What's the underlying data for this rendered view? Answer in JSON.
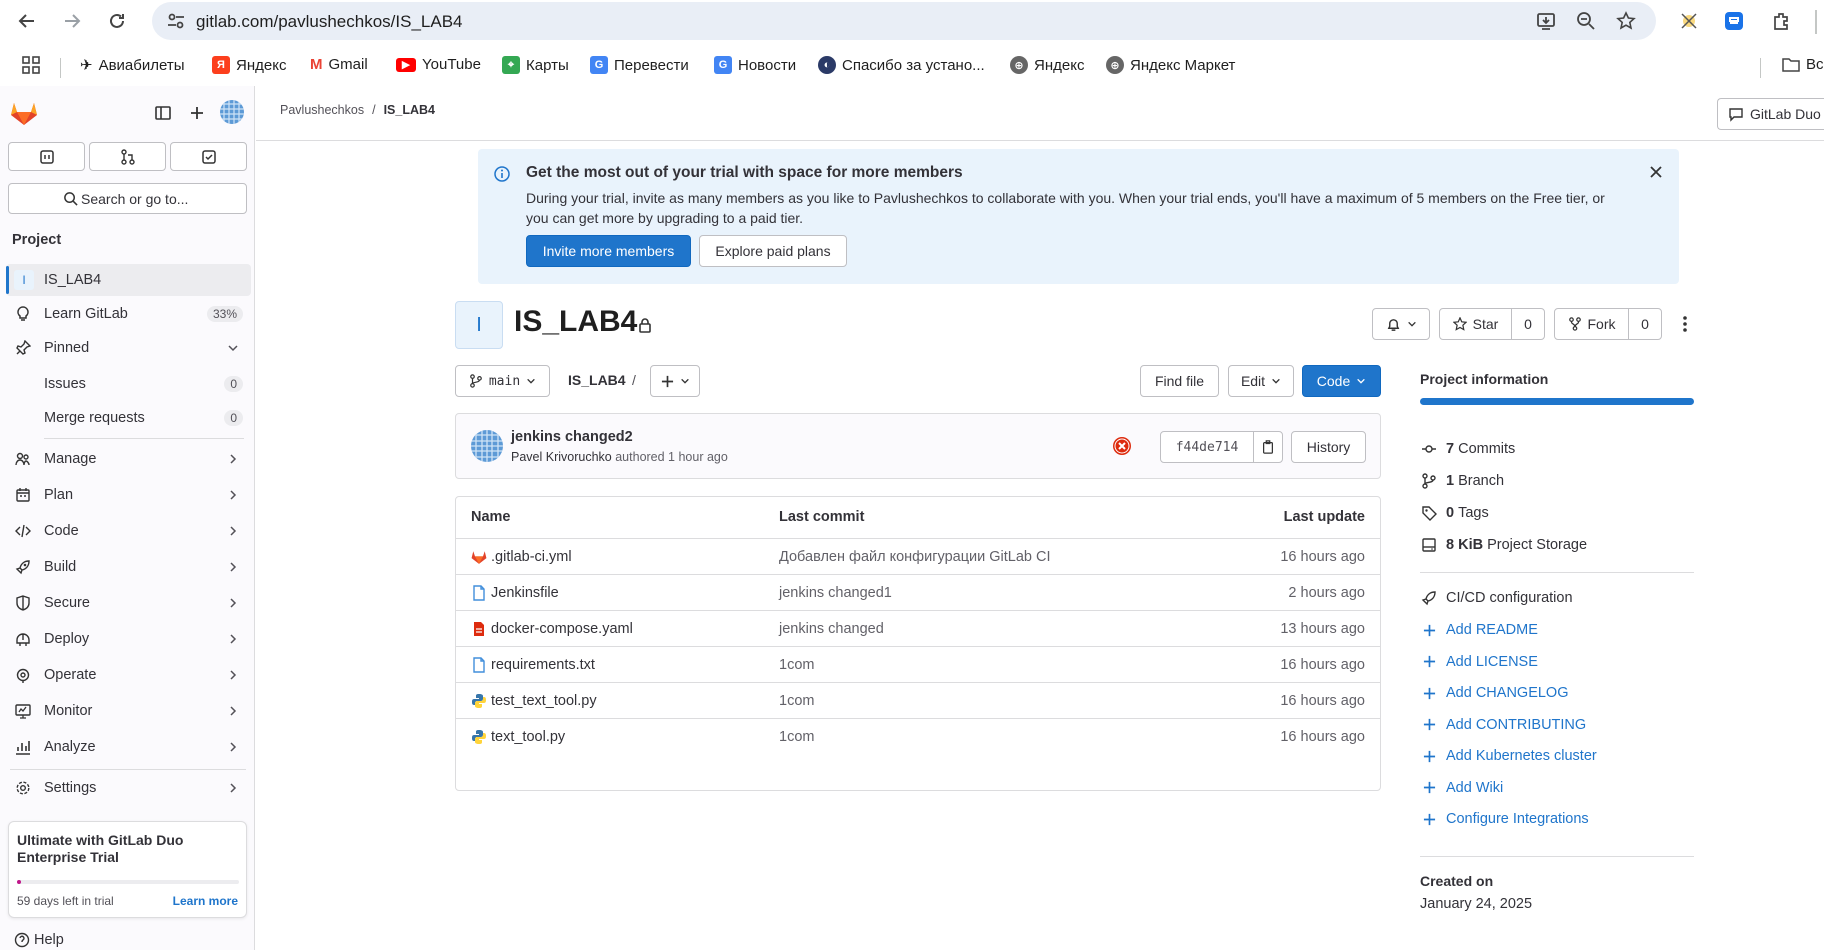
{
  "browser": {
    "url": "gitlab.com/pavlushechkos/IS_LAB4",
    "bookmarks": [
      "Авиабилеты",
      "Яндекс",
      "Gmail",
      "YouTube",
      "Карты",
      "Перевести",
      "Новости",
      "Спасибо за устано...",
      "Яндекс",
      "Яндекс Маркет"
    ],
    "bookmarks_overflow": "Вс"
  },
  "sidebar": {
    "search_placeholder": "Search or go to...",
    "section_title": "Project",
    "project_initial": "I",
    "project_name": "IS_LAB4",
    "learn_label": "Learn GitLab",
    "learn_progress": "33%",
    "pinned_label": "Pinned",
    "issues_label": "Issues",
    "issues_count": "0",
    "mr_label": "Merge requests",
    "mr_count": "0",
    "menu": [
      "Manage",
      "Plan",
      "Code",
      "Build",
      "Secure",
      "Deploy",
      "Operate",
      "Monitor",
      "Analyze"
    ],
    "settings_label": "Settings",
    "trial_title": "Ultimate with GitLab Duo Enterprise Trial",
    "trial_days": "59 days left in trial",
    "trial_learn": "Learn more",
    "help_label": "Help"
  },
  "topbar": {
    "breadcrumb_group": "Pavlushechkos",
    "breadcrumb_project": "IS_LAB4",
    "duo_label": "GitLab Duo"
  },
  "banner": {
    "title": "Get the most out of your trial with space for more members",
    "text": "During your trial, invite as many members as you like to Pavlushechkos to collaborate with you. When your trial ends, you'll have a maximum of 5 members on the Free tier, or you can get more by upgrading to a paid tier.",
    "primary_btn": "Invite more members",
    "secondary_btn": "Explore paid plans"
  },
  "project": {
    "avatar_letter": "I",
    "title": "IS_LAB4",
    "star_label": "Star",
    "star_count": "0",
    "fork_label": "Fork",
    "fork_count": "0"
  },
  "repo": {
    "branch": "main",
    "path": "IS_LAB4",
    "path_sep": "/",
    "find_file": "Find file",
    "edit": "Edit",
    "code": "Code"
  },
  "commit": {
    "title": "jenkins changed2",
    "author": "Pavel Krivoruchko",
    "meta": "authored 1 hour ago",
    "sha": "f44de714",
    "history": "History"
  },
  "files": {
    "headers": [
      "Name",
      "Last commit",
      "Last update"
    ],
    "rows": [
      {
        "name": ".gitlab-ci.yml",
        "commit": "Добавлен файл конфигурации GitLab CI",
        "updated": "16 hours ago",
        "icon": "gitlab-ci-icon",
        "color": "#e24329"
      },
      {
        "name": "Jenkinsfile",
        "commit": "jenkins changed1",
        "updated": "2 hours ago",
        "icon": "file-icon",
        "color": "#428fdc"
      },
      {
        "name": "docker-compose.yaml",
        "commit": "jenkins changed",
        "updated": "13 hours ago",
        "icon": "yaml-icon",
        "color": "#dd2b0e"
      },
      {
        "name": "requirements.txt",
        "commit": "1com",
        "updated": "16 hours ago",
        "icon": "text-file-icon",
        "color": "#428fdc"
      },
      {
        "name": "test_text_tool.py",
        "commit": "1com",
        "updated": "16 hours ago",
        "icon": "python-icon",
        "color": "#3776ab"
      },
      {
        "name": "text_tool.py",
        "commit": "1com",
        "updated": "16 hours ago",
        "icon": "python-icon",
        "color": "#3776ab"
      }
    ]
  },
  "info": {
    "title": "Project information",
    "commits_n": "7",
    "commits_l": "Commits",
    "branch_n": "1",
    "branch_l": "Branch",
    "tags_n": "0",
    "tags_l": "Tags",
    "storage_n": "8 KiB",
    "storage_l": "Project Storage",
    "cicd": "CI/CD configuration",
    "links": [
      "Add README",
      "Add LICENSE",
      "Add CHANGELOG",
      "Add CONTRIBUTING",
      "Add Kubernetes cluster",
      "Add Wiki",
      "Configure Integrations"
    ],
    "created_label": "Created on",
    "created_date": "January 24, 2025"
  },
  "colors": {
    "accent": "#1f75cb",
    "banner_bg": "#e9f3fc",
    "failed": "#dd2b0e"
  }
}
